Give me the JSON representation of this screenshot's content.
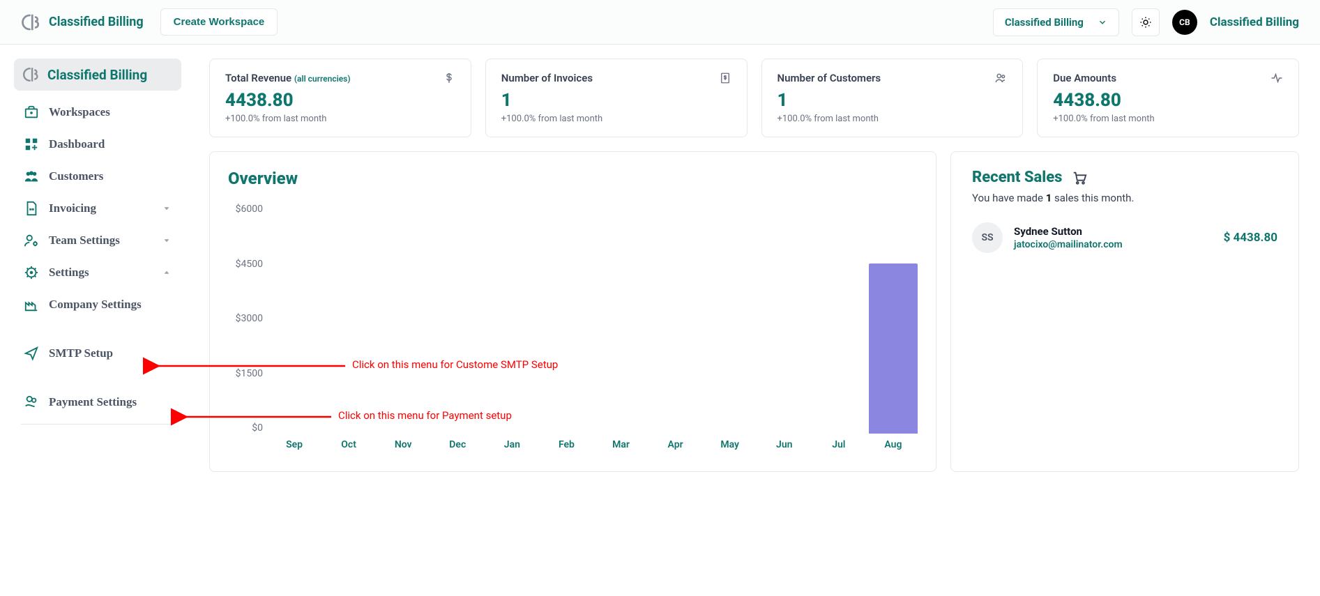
{
  "brand": "Classified Billing",
  "create_workspace_label": "Create Workspace",
  "workspace_selector_label": "Classified Billing",
  "avatar_initials": "CB",
  "user_name": "Classified Billing",
  "sidebar": {
    "header": "Classified Billing",
    "items": [
      {
        "label": "Workspaces"
      },
      {
        "label": "Dashboard"
      },
      {
        "label": "Customers"
      },
      {
        "label": "Invoicing",
        "caret": "down"
      },
      {
        "label": "Team Settings",
        "caret": "down"
      },
      {
        "label": "Settings",
        "caret": "up"
      },
      {
        "label": "Company Settings"
      },
      {
        "label": "SMTP Setup"
      },
      {
        "label": "Payment Settings"
      }
    ]
  },
  "stats": [
    {
      "title": "Total Revenue",
      "hint": "(all currencies)",
      "value": "4438.80",
      "change": "+100.0% from last month",
      "icon": "dollar"
    },
    {
      "title": "Number of Invoices",
      "hint": "",
      "value": "1",
      "change": "+100.0% from last month",
      "icon": "invoice"
    },
    {
      "title": "Number of Customers",
      "hint": "",
      "value": "1",
      "change": "+100.0% from last month",
      "icon": "people"
    },
    {
      "title": "Due Amounts",
      "hint": "",
      "value": "4438.80",
      "change": "+100.0% from last month",
      "icon": "activity"
    }
  ],
  "overview": {
    "title": "Overview"
  },
  "recent": {
    "title": "Recent Sales",
    "sub_prefix": "You have made ",
    "sub_count": "1",
    "sub_suffix": " sales this month.",
    "sales": [
      {
        "initials": "SS",
        "name": "Sydnee Sutton",
        "email": "jatocixo@mailinator.com",
        "amount_prefix": "$ ",
        "amount": "4438.80"
      }
    ]
  },
  "chart_data": {
    "type": "bar",
    "categories": [
      "Sep",
      "Oct",
      "Nov",
      "Dec",
      "Jan",
      "Feb",
      "Mar",
      "Apr",
      "May",
      "Jun",
      "Jul",
      "Aug"
    ],
    "values": [
      0,
      0,
      0,
      0,
      0,
      0,
      0,
      0,
      0,
      0,
      0,
      4438.8
    ],
    "y_ticks": [
      "$6000",
      "$4500",
      "$3000",
      "$1500",
      "$0"
    ],
    "ylim": [
      0,
      6000
    ],
    "title": "Overview",
    "xlabel": "",
    "ylabel": ""
  },
  "annotations": {
    "smtp": "Click on this menu for Custome SMTP Setup",
    "payment": "Click on this menu for Payment setup"
  }
}
